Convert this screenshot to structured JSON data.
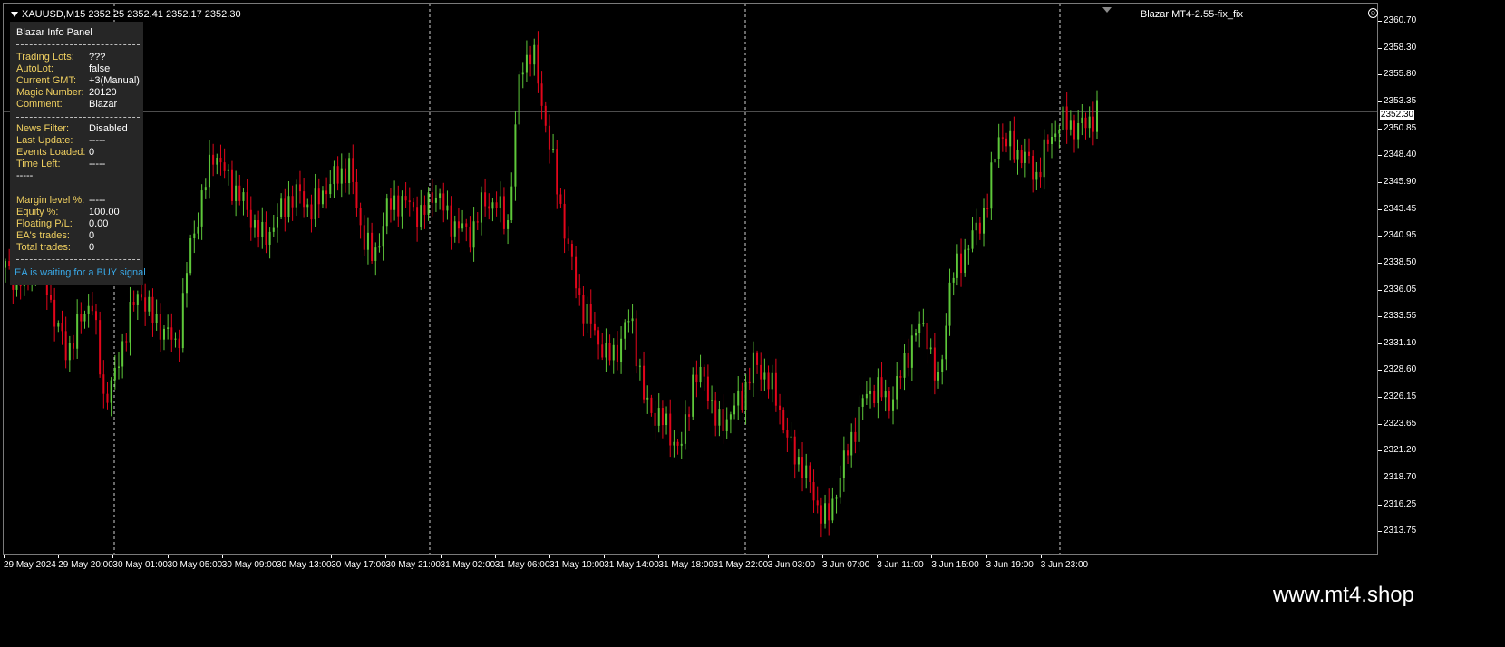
{
  "header": {
    "symbol_info": "XAUUSD,M15  2352.25 2352.41 2352.17 2352.30",
    "ea_name": "Blazar MT4-2.55-fix_fix"
  },
  "icons": {
    "symbol_menu": "triangle-down-icon",
    "ea_status": "smiley-icon",
    "chart_shift": "triangle-down-icon"
  },
  "info_panel": {
    "title": "Blazar Info Panel",
    "section1": [
      {
        "key": "Trading Lots:",
        "value": "???"
      },
      {
        "key": "AutoLot:",
        "value": "false"
      },
      {
        "key": "Current GMT:",
        "value": "+3(Manual)"
      },
      {
        "key": "Magic Number:",
        "value": "20120"
      },
      {
        "key": "Comment:",
        "value": "Blazar"
      }
    ],
    "section2": [
      {
        "key": "News Filter:",
        "value": "Disabled"
      },
      {
        "key": "Last Update:",
        "value": "-----"
      },
      {
        "key": "Events Loaded:",
        "value": "0"
      },
      {
        "key": "Time Left:",
        "value": "-----"
      }
    ],
    "section2_extra": "-----",
    "section3": [
      {
        "key": "Margin level %:",
        "value": "-----"
      },
      {
        "key": "Equity %:",
        "value": "100.00"
      },
      {
        "key": "Floating P/L:",
        "value": "0.00"
      },
      {
        "key": "EA's trades:",
        "value": "0"
      },
      {
        "key": "Total trades:",
        "value": "0"
      }
    ],
    "signal": "EA is waiting for a BUY signal"
  },
  "price_axis": {
    "labels": [
      "2360.70",
      "2358.30",
      "2355.80",
      "2353.35",
      "2350.85",
      "2348.40",
      "2345.90",
      "2343.45",
      "2340.95",
      "2338.50",
      "2336.05",
      "2333.55",
      "2331.10",
      "2328.60",
      "2326.15",
      "2323.65",
      "2321.20",
      "2318.70",
      "2316.25",
      "2313.75"
    ],
    "current_price": "2352.30"
  },
  "time_axis": {
    "labels": [
      "29 May 2024",
      "29 May 20:00",
      "30 May 01:00",
      "30 May 05:00",
      "30 May 09:00",
      "30 May 13:00",
      "30 May 17:00",
      "30 May 21:00",
      "31 May 02:00",
      "31 May 06:00",
      "31 May 10:00",
      "31 May 14:00",
      "31 May 18:00",
      "31 May 22:00",
      "3 Jun 03:00",
      "3 Jun 07:00",
      "3 Jun 11:00",
      "3 Jun 15:00",
      "3 Jun 19:00",
      "3 Jun 23:00"
    ]
  },
  "colors": {
    "bull": "#5ec83a",
    "bear": "#e3061b",
    "background": "#000000",
    "panel": "#262626",
    "panel_key": "#f0d060",
    "signal": "#39a9e8"
  },
  "footer": {
    "brand": "www.mt4.shop"
  },
  "chart_data": {
    "type": "candlestick",
    "symbol": "XAUUSD",
    "timeframe": "M15",
    "ylim": [
      2313.75,
      2361.5
    ],
    "current_price": 2352.3,
    "series": [
      {
        "name": "close",
        "values": [
          2338.5,
          2337.3,
          2338.0,
          2339.0,
          2334.0,
          2331.0,
          2333.5,
          2336.0,
          2327.0,
          2329.0,
          2334.0,
          2336.5,
          2334.0,
          2333.0,
          2331.5,
          2340.0,
          2344.5,
          2349.0,
          2346.5,
          2345.0,
          2343.0,
          2341.0,
          2342.5,
          2344.5,
          2345.0,
          2343.5,
          2345.5,
          2346.5,
          2347.5,
          2342.0,
          2339.0,
          2343.5,
          2344.5,
          2344.0,
          2343.0,
          2345.5,
          2343.0,
          2342.0,
          2341.5,
          2344.5,
          2344.0,
          2342.5,
          2356.5,
          2357.5,
          2351.5,
          2345.5,
          2339.5,
          2335.0,
          2333.0,
          2330.5,
          2331.5,
          2334.5,
          2327.0,
          2325.5,
          2324.5,
          2322.0,
          2328.5,
          2329.0,
          2324.5,
          2325.5,
          2327.0,
          2330.0,
          2329.0,
          2326.5,
          2322.5,
          2321.0,
          2318.0,
          2316.0,
          2320.0,
          2323.5,
          2327.0,
          2328.0,
          2326.5,
          2329.0,
          2332.5,
          2333.5,
          2327.5,
          2337.0,
          2339.5,
          2341.5,
          2344.0,
          2350.5,
          2349.0,
          2348.5,
          2346.5,
          2349.5,
          2351.5,
          2351.0,
          2351.0,
          2352.3
        ]
      }
    ]
  }
}
